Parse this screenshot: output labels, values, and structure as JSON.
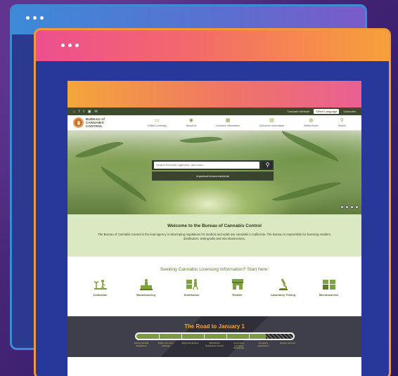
{
  "site": {
    "util": {
      "social": [
        "⌂",
        "f",
        "t",
        "▣",
        "✉"
      ],
      "links": [
        "Translate Website",
        "Select Language",
        "Subscribe"
      ]
    },
    "logo": {
      "line1": "BUREAU of",
      "line2": "CANNABIS",
      "line3": "CONTROL"
    },
    "nav": [
      {
        "icon": "monitor-icon",
        "glyph": "▭",
        "label": "Online Licensing"
      },
      {
        "icon": "eye-icon",
        "glyph": "◉",
        "label": "About Us"
      },
      {
        "icon": "calendar-icon",
        "glyph": "▦",
        "label": "Licensee Information"
      },
      {
        "icon": "document-icon",
        "glyph": "▤",
        "label": "Consumer Information"
      },
      {
        "icon": "globe-icon",
        "glyph": "◍",
        "label": "Media Room"
      },
      {
        "icon": "search-icon",
        "glyph": "⚲",
        "label": "Search"
      }
    ],
    "search": {
      "placeholder": "Search Services, Agencies, and more...",
      "button": "⚲"
    },
    "announcement": "Important Announcements",
    "pager": [
      "1",
      "2",
      "3",
      "4"
    ],
    "welcome": {
      "title": "Welcome to the Bureau of Cannabis Control",
      "body": "The Bureau of Cannabis Control is the lead agency in developing regulations for medical and adult-use cannabis in California. The Bureau is responsible for licensing retailers, distributors, testing labs and microbusinesses."
    },
    "seek": {
      "title": "Seeking Cannabis Licensing Information? Start here:",
      "categories": [
        "Cultivation",
        "Manufacturing",
        "Distribution",
        "Retailer",
        "Laboratory Testing",
        "Microbusiness"
      ]
    },
    "road": {
      "title": "The Road to January 1",
      "milestones": [
        "Issuing Medical Regulations",
        "Public Comment Hearings",
        "CEQA Workshops",
        "MAUCRSA Regulations Issued",
        "Community Licensing Workshops",
        "Accepting Applications",
        "Issuing Licenses"
      ],
      "progress": 0.83
    }
  },
  "colors": {
    "accent": "#7ea23f",
    "hero_dark": "#2f3a26",
    "welcome_bg": "#dbe9c2",
    "road_title": "#f0a632"
  }
}
